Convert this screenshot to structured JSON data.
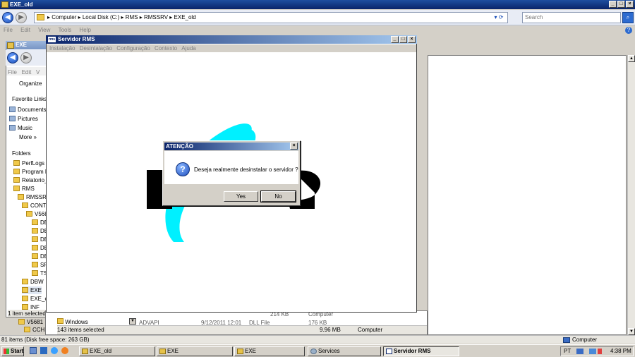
{
  "window": {
    "title": "EXE_old"
  },
  "address": {
    "crumbs": "▸ Computer ▸ Local Disk (C:) ▸ RMS ▸ RMSSRV ▸ EXE_old",
    "search_placeholder": "Search"
  },
  "menu": [
    "File",
    "Edit",
    "View",
    "Tools",
    "Help"
  ],
  "explorer2": {
    "title": "EXE",
    "menu": [
      "File",
      "Edit",
      "V"
    ],
    "organize": "Organize",
    "favorites_header": "Favorite Links",
    "favorites": [
      "Documents",
      "Pictures",
      "Music",
      "More »"
    ],
    "folders_header": "Folders",
    "tree": [
      "PerfLogs",
      "Program Fi",
      "Relatorio_f",
      "RMS",
      "RMSSRV",
      "CONTE",
      "V568",
      "DE",
      "DE",
      "DE",
      "DE",
      "DE",
      "SR",
      "TS",
      "DBW",
      "EXE",
      "EXE_ol",
      "INF"
    ],
    "status": "1 item selected"
  },
  "behind": {
    "row1_name": "Windows",
    "row1_cols": [
      "ADVAPI",
      "9/12/2011 12:01",
      "DLL File",
      "176 KB"
    ],
    "row0_cols": [
      "214 KB",
      "Computer"
    ],
    "status_left": "143 items selected",
    "status_size": "9.96 MB",
    "status_zone": "Computer",
    "tree_extra": [
      "V5681",
      "CCH"
    ]
  },
  "rms": {
    "title": "Servidor RMS",
    "menu": [
      "Instalação",
      "Desintalação",
      "Configuração",
      "Contexto",
      "Ajuda"
    ]
  },
  "dialog": {
    "title": "ATENÇÃO",
    "message": "Deseja realmente desinstalar o servidor ?",
    "yes": "Yes",
    "no": "No"
  },
  "status_bar": {
    "left": "81 items (Disk free space: 263 GB)",
    "right": "Computer"
  },
  "taskbar": {
    "start": "Start",
    "tasks": [
      "EXE_old",
      "EXE",
      "EXE",
      "Services",
      "Servidor RMS"
    ],
    "lang": "PT",
    "time": "4:38 PM"
  },
  "colors": {
    "accent": "#0a246a",
    "logo_cyan": "#00f0ff"
  }
}
